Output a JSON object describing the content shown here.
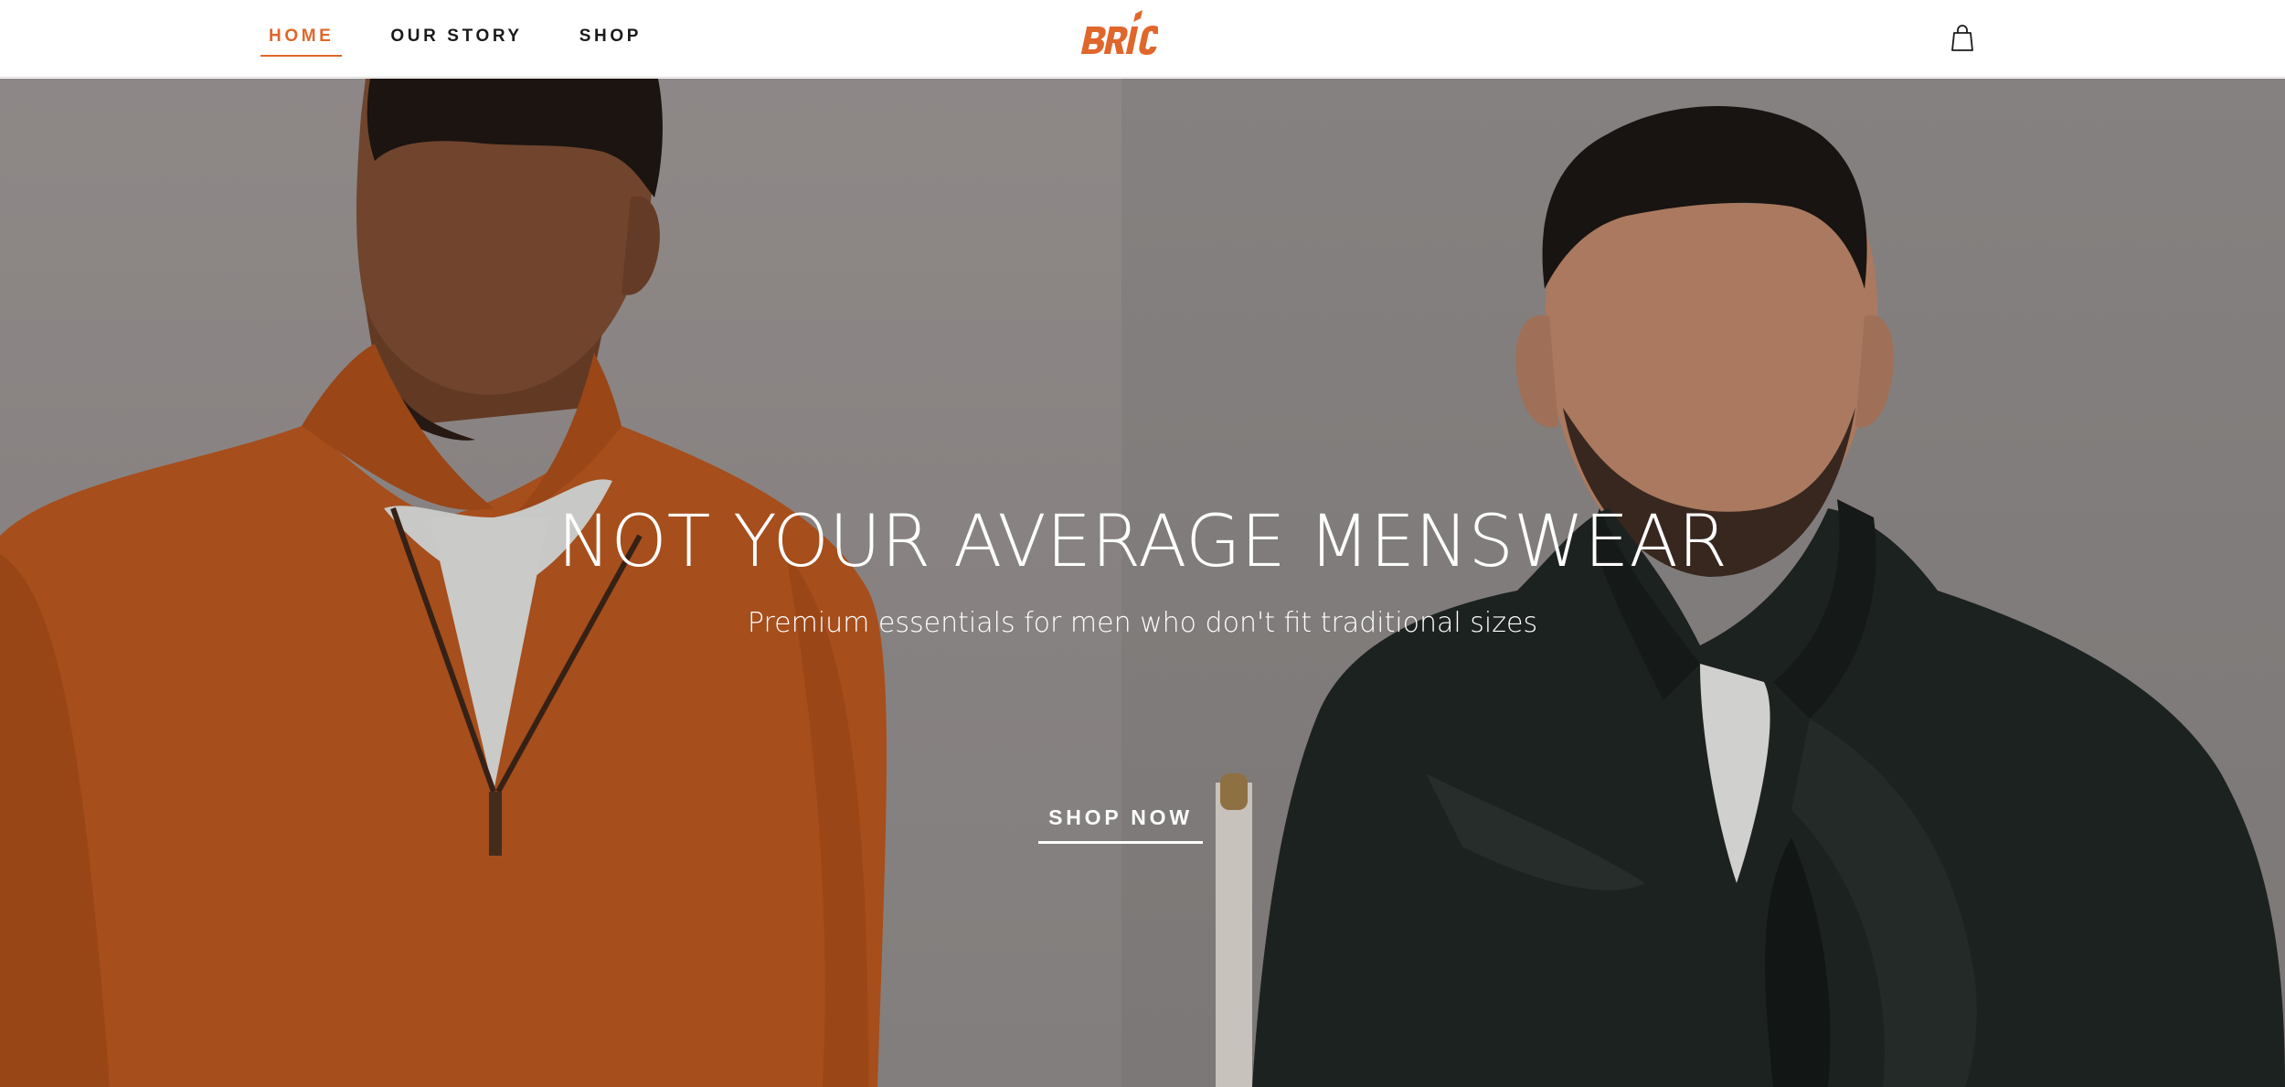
{
  "header": {
    "nav": [
      {
        "label": "HOME",
        "active": true
      },
      {
        "label": "OUR STORY",
        "active": false
      },
      {
        "label": "SHOP",
        "active": false
      }
    ],
    "logo_text": "BRIC",
    "cart_icon": "shopping-bag-icon"
  },
  "hero": {
    "title": "NOT YOUR AVERAGE MENSWEAR",
    "subtitle": "Premium essentials for men who don't fit traditional sizes",
    "cta_label": "SHOP NOW"
  },
  "colors": {
    "accent": "#e0672c",
    "text_dark": "#1a1a1a",
    "hero_text": "#ffffff"
  }
}
